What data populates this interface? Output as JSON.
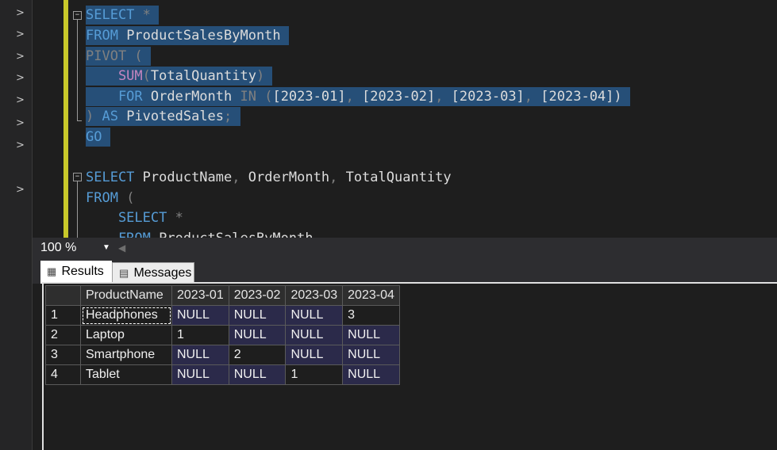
{
  "left_gutter": {
    "chevron_glyph": ">",
    "chevron_count": 8
  },
  "editor": {
    "lines": [
      [
        "SELECT",
        " *"
      ],
      [
        "FROM",
        " ProductSalesByMonth"
      ],
      [
        "PIVOT",
        " ("
      ],
      [
        "    SUM",
        "(",
        "TotalQuantity",
        ")"
      ],
      [
        "    FOR",
        " OrderMonth ",
        "IN",
        " (",
        "[2023-01]",
        ", ",
        "[2023-02]",
        ", ",
        "[2023-03]",
        ", ",
        "[2023-04]",
        ")"
      ],
      [
        ")",
        " AS",
        " PivotedSales",
        ";"
      ],
      [
        "GO"
      ],
      [],
      [
        "SELECT",
        " ProductName",
        ", ",
        "OrderMonth",
        ", ",
        "TotalQuantity"
      ],
      [
        "FROM",
        " ("
      ],
      [
        "    SELECT",
        " *"
      ],
      [
        "    FROM",
        " ProductSalesByMonth"
      ]
    ]
  },
  "zoom": {
    "value": "100 %"
  },
  "tabs": {
    "results": "Results",
    "messages": "Messages"
  },
  "results": {
    "columns": [
      "ProductName",
      "2023-01",
      "2023-02",
      "2023-03",
      "2023-04"
    ],
    "rows": [
      {
        "num": "1",
        "cells": [
          "Headphones",
          "NULL",
          "NULL",
          "NULL",
          "3"
        ]
      },
      {
        "num": "2",
        "cells": [
          "Laptop",
          "1",
          "NULL",
          "NULL",
          "NULL"
        ]
      },
      {
        "num": "3",
        "cells": [
          "Smartphone",
          "NULL",
          "2",
          "NULL",
          "NULL"
        ]
      },
      {
        "num": "4",
        "cells": [
          "Tablet",
          "NULL",
          "NULL",
          "1",
          "NULL"
        ]
      }
    ]
  },
  "colors": {
    "selection": "#264f78",
    "keyword": "#569cd6",
    "function": "#c586c0",
    "margin": "#c8c82a",
    "cell_highlight": "#2b2a4a"
  }
}
